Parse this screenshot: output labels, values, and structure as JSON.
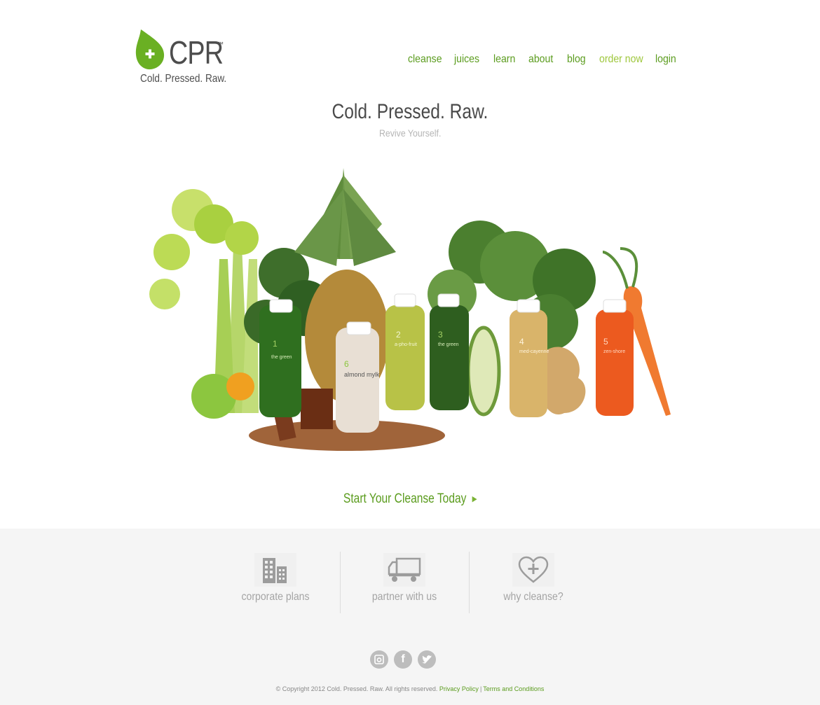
{
  "brand": {
    "name": "CPR",
    "trademark": "™",
    "tagline": "Cold. Pressed. Raw.",
    "color_primary": "#5b9c1e",
    "color_leaf": "#6ab023",
    "color_accent": "#9ec73c"
  },
  "nav": {
    "items": [
      {
        "label": "cleanse"
      },
      {
        "label": "juices"
      },
      {
        "label": "learn"
      },
      {
        "label": "about"
      },
      {
        "label": "blog"
      },
      {
        "label": "order now",
        "accent": true
      },
      {
        "label": "login"
      }
    ]
  },
  "hero": {
    "title": "Cold. Pressed. Raw.",
    "subtitle": "Revive Yourself.",
    "cta_label": "Start Your Cleanse Today",
    "cta_icon": "play-arrow-icon",
    "bottles": [
      {
        "number": "1",
        "name": "the green",
        "color": "#2f6f1f"
      },
      {
        "number": "6",
        "name": "almond mylk",
        "color": "#e8dfd4"
      },
      {
        "number": "2",
        "name": "a-pho-fruit",
        "color": "#b8c247"
      },
      {
        "number": "3",
        "name": "the green",
        "color": "#2e5e1f"
      },
      {
        "number": "4",
        "name": "med-cayenne",
        "color": "#d9b46a"
      },
      {
        "number": "5",
        "name": "zen-shore",
        "color": "#ec5a1f"
      }
    ]
  },
  "footer": {
    "features": [
      {
        "label": "corporate plans",
        "icon": "building-icon"
      },
      {
        "label": "partner with us",
        "icon": "truck-icon"
      },
      {
        "label": "why cleanse?",
        "icon": "heart-plus-icon"
      }
    ],
    "social": [
      {
        "icon": "instagram-icon"
      },
      {
        "icon": "facebook-icon"
      },
      {
        "icon": "twitter-icon"
      }
    ],
    "copyright": "© Copyright 2012 Cold. Pressed. Raw. All rights reserved.",
    "privacy_label": "Privacy Policy",
    "separator": "|",
    "terms_label": "Terms and Conditions"
  }
}
